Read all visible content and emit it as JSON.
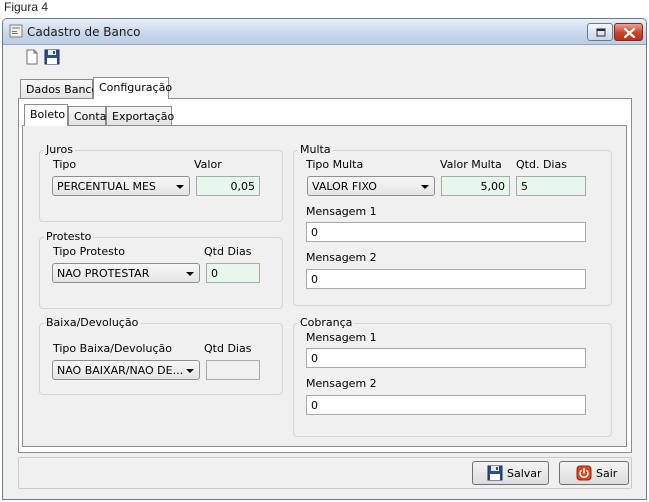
{
  "caption": "Figura 4",
  "window": {
    "title": "Cadastro de Banco"
  },
  "tabs": {
    "dados_banco": "Dados Banco",
    "configuracao": "Configuração"
  },
  "subtabs": {
    "boleto": "Boleto",
    "conta": "Conta",
    "exportacao": "Exportação"
  },
  "juros": {
    "title": "Juros",
    "tipo_label": "Tipo",
    "valor_label": "Valor",
    "tipo_value": "PERCENTUAL MES",
    "valor_value": "0,05"
  },
  "protesto": {
    "title": "Protesto",
    "tipo_label": "Tipo Protesto",
    "dias_label": "Qtd Dias",
    "tipo_value": "NAO PROTESTAR",
    "dias_value": "0"
  },
  "baixa": {
    "title": "Baixa/Devolução",
    "tipo_label": "Tipo Baixa/Devolução",
    "dias_label": "Qtd Dias",
    "tipo_value": "NAO BAIXAR/NAO DE...",
    "dias_value": ""
  },
  "multa": {
    "title": "Multa",
    "tipo_label": "Tipo Multa",
    "valor_label": "Valor Multa",
    "dias_label": "Qtd. Dias",
    "tipo_value": "VALOR FIXO",
    "valor_value": "5,00",
    "dias_value": "5",
    "msg1_label": "Mensagem 1",
    "msg1_value": "0",
    "msg2_label": "Mensagem 2",
    "msg2_value": "0"
  },
  "cobranca": {
    "title": "Cobrança",
    "msg1_label": "Mensagem 1",
    "msg1_value": "0",
    "msg2_label": "Mensagem 2",
    "msg2_value": "0"
  },
  "buttons": {
    "salvar": "Salvar",
    "sair": "Sair"
  },
  "icons": {
    "app": "window-app-icon",
    "new": "new-document-icon",
    "save": "floppy-disk-icon",
    "exit": "power-icon"
  },
  "colors": {
    "required_field": "#e6f8ec",
    "close_button": "#c7432a"
  }
}
